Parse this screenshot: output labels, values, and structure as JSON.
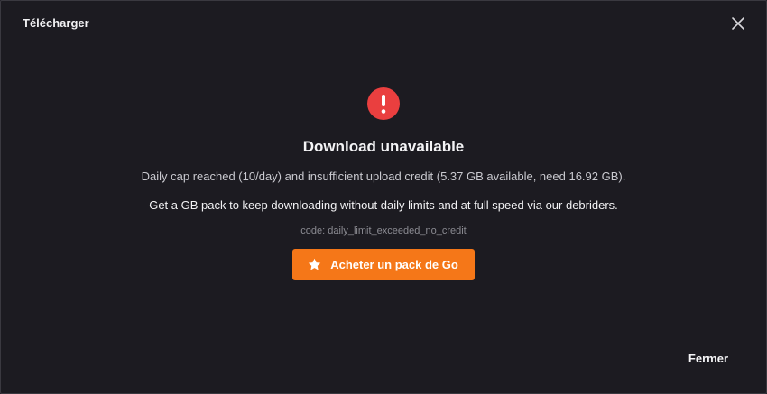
{
  "dialog": {
    "title": "Télécharger",
    "close_icon": "close-icon",
    "alert_icon": "exclamation-circle-icon",
    "heading": "Download unavailable",
    "message": "Daily cap reached (10/day) and insufficient upload credit (5.37 GB available, need 16.92 GB).",
    "promo": "Get a GB pack to keep downloading without daily limits and at full speed via our debriders.",
    "code": "code: daily_limit_exceeded_no_credit",
    "cta": {
      "label": "Acheter un pack de Go",
      "icon": "star-icon",
      "color": "#f57718"
    },
    "footer_button": "Fermer",
    "alert_color": "#ea3f3f",
    "background": "#1c1b21"
  }
}
